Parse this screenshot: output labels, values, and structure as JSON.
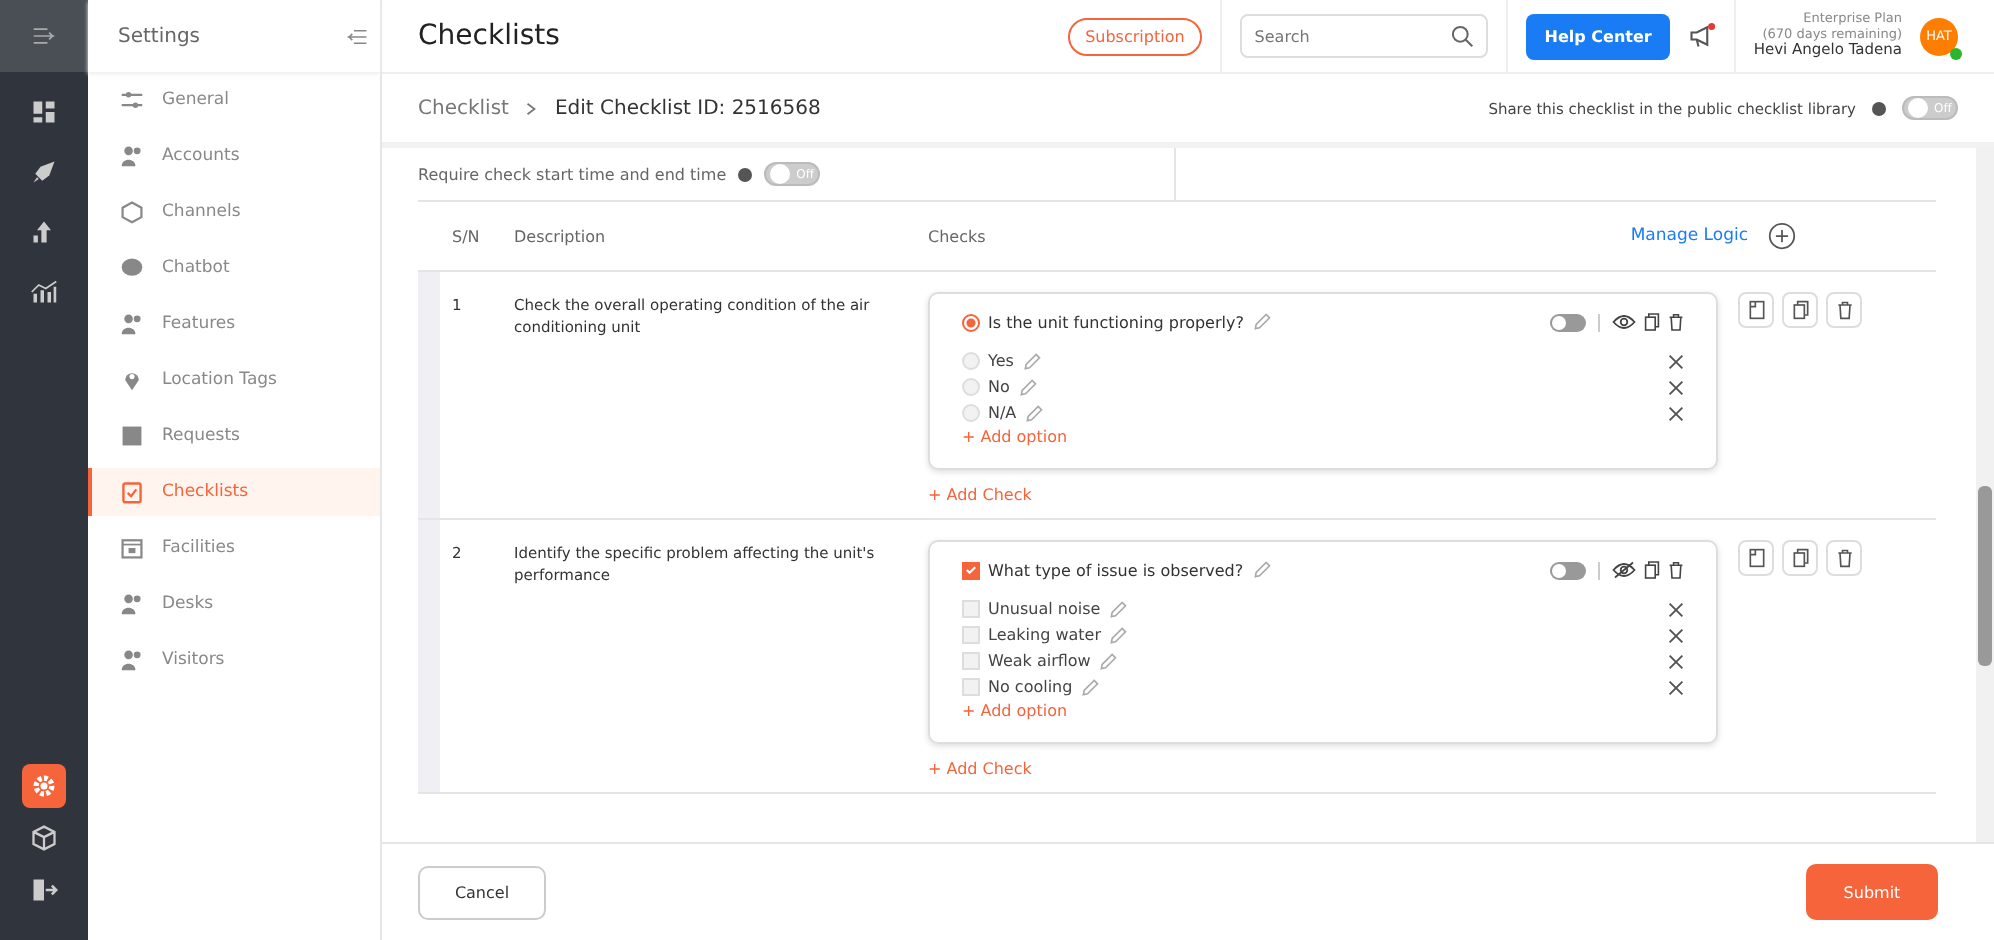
{
  "rail": [
    {
      "kind": "dashboard",
      "selected": false
    },
    {
      "kind": "rocket",
      "selected": false
    },
    {
      "kind": "upload",
      "selected": false
    },
    {
      "kind": "stats",
      "selected": false
    },
    {
      "kind": "settings",
      "selected": true
    },
    {
      "kind": "cube",
      "selected": false
    },
    {
      "kind": "logout",
      "selected": false
    }
  ],
  "sidebar": {
    "title": "Settings",
    "items": [
      {
        "label": "General",
        "selected": false
      },
      {
        "label": "Accounts",
        "selected": false
      },
      {
        "label": "Channels",
        "selected": false
      },
      {
        "label": "Chatbot",
        "selected": false
      },
      {
        "label": "Features",
        "selected": false
      },
      {
        "label": "Location Tags",
        "selected": false
      },
      {
        "label": "Requests",
        "selected": false
      },
      {
        "label": "Checklists",
        "selected": true
      },
      {
        "label": "Facilities",
        "selected": false
      },
      {
        "label": "Desks",
        "selected": false
      },
      {
        "label": "Visitors",
        "selected": false
      }
    ]
  },
  "header": {
    "title": "Checklists",
    "subscription": "Subscription",
    "search": {
      "placeholder": "Search"
    },
    "help": "Help Center",
    "notification_unread": true,
    "plan": "Enterprise Plan",
    "remaining": "(670 days remaining)",
    "user": "Hevi Angelo Tadena",
    "avatar": "HAT",
    "online": true
  },
  "breadcrumb": {
    "parent": "Checklist",
    "current": "Edit Checklist ID: 2516568"
  },
  "share": {
    "label": "Share this checklist in the public checklist library",
    "on": false,
    "toggle_label": "Off"
  },
  "require_time": {
    "label": "Require check start time and end time",
    "on": false,
    "toggle_label": "Off"
  },
  "table": {
    "columns": [
      "S/N",
      "Description",
      "Checks"
    ],
    "manage_logic": "Manage Logic"
  },
  "rows": [
    {
      "sn": "1",
      "description": "Check the overall operating condition of the air conditioning unit",
      "check": {
        "kind": "radio",
        "question": "Is the unit functioning properly?",
        "checked": true,
        "required": false,
        "visible": true,
        "options": [
          {
            "label": "Yes",
            "checked": false
          },
          {
            "label": "No",
            "checked": false
          },
          {
            "label": "N/A",
            "checked": false
          }
        ],
        "add_option": "+ Add option"
      },
      "add_check": "+ Add Check"
    },
    {
      "sn": "2",
      "description": "Identify the specific problem affecting the unit's performance",
      "check": {
        "kind": "checkbox",
        "question": "What type of issue is observed?",
        "checked": true,
        "required": false,
        "visible": false,
        "options": [
          {
            "label": "Unusual noise",
            "checked": false
          },
          {
            "label": "Leaking water",
            "checked": false
          },
          {
            "label": "Weak airflow",
            "checked": false
          },
          {
            "label": "No cooling",
            "checked": false
          }
        ],
        "add_option": "+ Add option"
      },
      "add_check": "+ Add Check"
    }
  ],
  "footer": {
    "cancel": "Cancel",
    "submit": "Submit"
  }
}
